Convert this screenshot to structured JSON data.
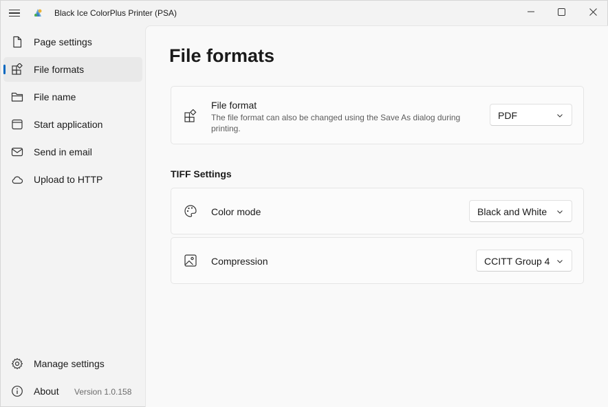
{
  "window": {
    "title": "Black Ice ColorPlus Printer (PSA)"
  },
  "sidebar": {
    "items": [
      {
        "label": "Page settings",
        "icon": "page-icon"
      },
      {
        "label": "File formats",
        "icon": "file-formats-icon",
        "active": true
      },
      {
        "label": "File name",
        "icon": "folder-icon"
      },
      {
        "label": "Start application",
        "icon": "application-window-icon"
      },
      {
        "label": "Send in email",
        "icon": "mail-icon"
      },
      {
        "label": "Upload to HTTP",
        "icon": "cloud-icon"
      }
    ],
    "footer": [
      {
        "label": "Manage settings",
        "icon": "gear-icon"
      },
      {
        "label": "About",
        "icon": "info-icon",
        "version": "Version 1.0.158"
      }
    ]
  },
  "main": {
    "title": "File formats",
    "file_format": {
      "title": "File format",
      "description": "The file format can also be changed using the Save As dialog during printing.",
      "value": "PDF"
    },
    "tiff_section": {
      "header": "TIFF Settings",
      "color_mode": {
        "title": "Color mode",
        "value": "Black and White"
      },
      "compression": {
        "title": "Compression",
        "value": "CCITT Group 4"
      }
    }
  },
  "colors": {
    "accent": "#0067c0",
    "sidebar_bg": "#f3f3f3",
    "content_bg": "#f9f9f9",
    "card_bg": "#fbfbfb"
  }
}
